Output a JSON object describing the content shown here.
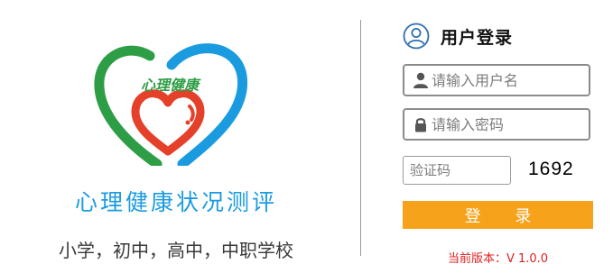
{
  "brand": {
    "logo_text": "心理健康",
    "title": "心理健康状况测评",
    "subtitle": "小学，初中，高中，中职学校"
  },
  "login": {
    "title": "用户登录",
    "header_icon": "user-circle-icon",
    "username": {
      "placeholder": "请输入用户名",
      "value": "",
      "icon": "user-icon"
    },
    "password": {
      "placeholder": "请输入密码",
      "value": "",
      "icon": "lock-icon"
    },
    "captcha": {
      "placeholder": "验证码",
      "value": "",
      "code": "1692"
    },
    "submit_label": "登 录",
    "version": "当前版本：V 1.0.0"
  },
  "colors": {
    "brand_blue": "#1a9be0",
    "logo_green": "#2e9e46",
    "logo_red": "#e5402a",
    "button_orange": "#f7a21b",
    "version_red": "#e02020"
  }
}
